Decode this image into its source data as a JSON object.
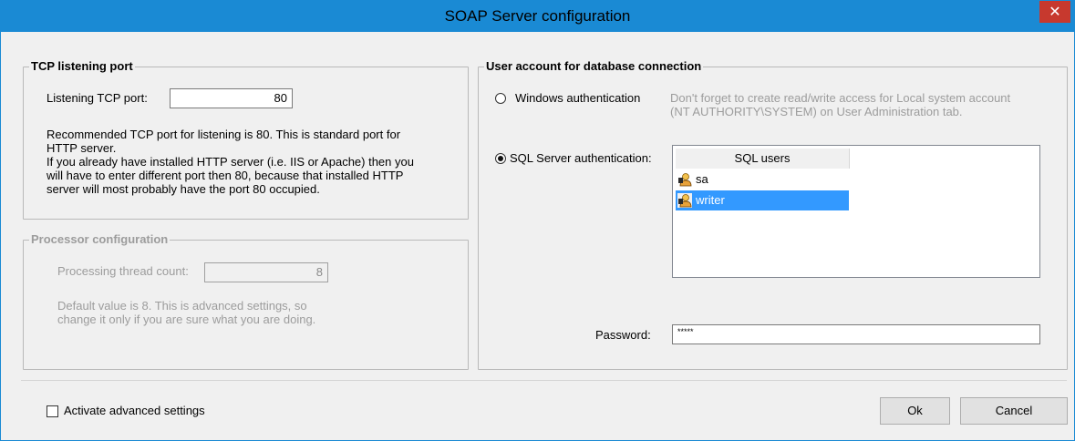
{
  "window": {
    "title": "SOAP Server configuration",
    "close_glyph": "✕"
  },
  "tcp": {
    "legend": "TCP listening port",
    "port_label": "Listening TCP port:",
    "port_value": "80",
    "info_lines": [
      "Recommended TCP port for listening is 80. This is standard port for",
      "HTTP server.",
      "If you already have installed HTTP server (i.e. IIS or Apache) then you",
      "will have to enter different port then 80, because that installed HTTP",
      "server will most probably have the port 80 occupied."
    ]
  },
  "processor": {
    "legend": "Processor configuration",
    "thread_label": "Processing thread count:",
    "thread_value": "8",
    "info_lines": [
      "Default value is 8. This is advanced settings, so",
      "change it only if you are sure what you are doing."
    ]
  },
  "account": {
    "legend": "User account for database connection",
    "windows_auth_label": "Windows authentication",
    "windows_auth_note_lines": [
      "Don't forget to create read/write access for Local system account",
      "(NT AUTHORITY\\SYSTEM) on User Administration tab."
    ],
    "sql_auth_label": "SQL Server authentication:",
    "selected_auth": "sql",
    "users_header": "SQL users",
    "users": [
      {
        "name": "sa",
        "icon": "user-icon",
        "selected": false
      },
      {
        "name": "writer",
        "icon": "user-icon",
        "selected": true
      }
    ],
    "password_label": "Password:",
    "password_value": "*****"
  },
  "footer": {
    "advanced_label": "Activate advanced settings",
    "advanced_checked": false,
    "ok_label": "Ok",
    "cancel_label": "Cancel"
  },
  "colors": {
    "title_bar": "#1a8ad4",
    "close_button": "#c7392e",
    "selection": "#3399ff",
    "disabled_text": "#9c9c9c"
  }
}
